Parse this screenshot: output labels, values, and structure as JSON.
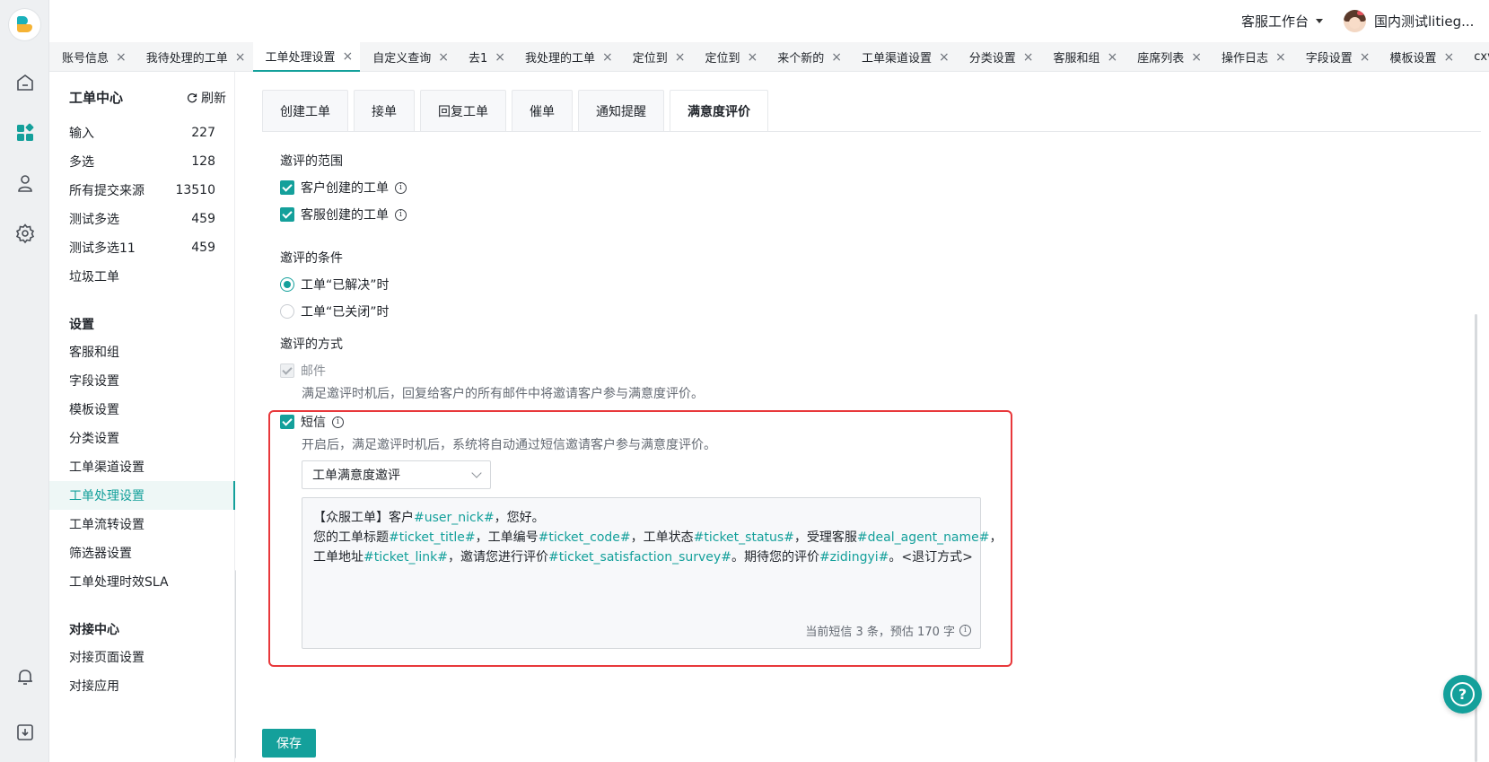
{
  "rail": {
    "icons": [
      "logo-icon",
      "home-icon",
      "apps-icon",
      "user-icon",
      "settings-icon",
      "bell-icon",
      "download-icon"
    ]
  },
  "topbar": {
    "workspace": "客服工作台",
    "user_name": "国内测试litieg..."
  },
  "tabs": [
    {
      "label": "账号信息"
    },
    {
      "label": "我待处理的工单"
    },
    {
      "label": "工单处理设置",
      "active": true
    },
    {
      "label": "自定义查询"
    },
    {
      "label": "去1"
    },
    {
      "label": "我处理的工单"
    },
    {
      "label": "定位到"
    },
    {
      "label": "定位到"
    },
    {
      "label": "来个新的"
    },
    {
      "label": "工单渠道设置"
    },
    {
      "label": "分类设置"
    },
    {
      "label": "客服和组"
    },
    {
      "label": "座席列表"
    },
    {
      "label": "操作日志"
    },
    {
      "label": "字段设置"
    },
    {
      "label": "模板设置"
    },
    {
      "label": "cxvx"
    }
  ],
  "tab_close": "×",
  "sidebar": {
    "title": "工单中心",
    "refresh": "刷新",
    "views": [
      {
        "label": "输入",
        "count": "227"
      },
      {
        "label": "多选",
        "count": "128"
      },
      {
        "label": "所有提交来源",
        "count": "13510"
      },
      {
        "label": "测试多选",
        "count": "459"
      },
      {
        "label": "测试多选11",
        "count": "459"
      },
      {
        "label": "垃圾工单",
        "count": ""
      }
    ],
    "settings_title": "设置",
    "settings": [
      {
        "label": "客服和组"
      },
      {
        "label": "字段设置"
      },
      {
        "label": "模板设置"
      },
      {
        "label": "分类设置"
      },
      {
        "label": "工单渠道设置"
      },
      {
        "label": "工单处理设置",
        "active": true
      },
      {
        "label": "工单流转设置"
      },
      {
        "label": "筛选器设置"
      },
      {
        "label": "工单处理时效SLA"
      }
    ],
    "integration_title": "对接中心",
    "integration": [
      {
        "label": "对接页面设置"
      },
      {
        "label": "对接应用"
      }
    ]
  },
  "subtabs": [
    {
      "label": "创建工单"
    },
    {
      "label": "接单"
    },
    {
      "label": "回复工单"
    },
    {
      "label": "催单"
    },
    {
      "label": "通知提醒"
    },
    {
      "label": "满意度评价",
      "active": true
    }
  ],
  "scope": {
    "title": "邀评的范围",
    "options": [
      {
        "label": "客户创建的工单",
        "checked": true
      },
      {
        "label": "客服创建的工单",
        "checked": true
      }
    ]
  },
  "condition": {
    "title": "邀评的条件",
    "options": [
      {
        "label": "工单“已解决”时",
        "selected": true
      },
      {
        "label": "工单“已关闭”时",
        "selected": false
      }
    ]
  },
  "method": {
    "title": "邀评的方式",
    "email": {
      "label": "邮件",
      "checked": true,
      "disabled": true,
      "hint": "满足邀评时机后，回复给客户的所有邮件中将邀请客户参与满意度评价。"
    },
    "sms": {
      "label": "短信",
      "checked": true,
      "hint": "开启后，满足邀评时机后，系统将自动通过短信邀请客户参与满意度评价。",
      "template": "工单满意度邀评",
      "body": {
        "p1": "【众服工单】客户",
        "v1": "#user_nick#",
        "p2": "，您好。",
        "p3": "您的工单标题",
        "v2": "#ticket_title#",
        "p4": "，工单编号",
        "v3": "#ticket_code#",
        "p5": "，工单状态",
        "v4": "#ticket_status#",
        "p6": "，受理客服",
        "v5": "#deal_agent_name#",
        "p7": "，工单地址",
        "v6": "#ticket_link#",
        "p8": "，邀请您进行评价",
        "v7": "#ticket_satisfaction_survey#",
        "p9": "。期待您的评价",
        "v8": "#zidingyi#",
        "p10": "。<退订方式>"
      },
      "count": "当前短信 3 条，预估 170 字"
    }
  },
  "save_label": "保存",
  "help_label": "?",
  "colors": {
    "accent": "#14a09b",
    "highlight": "#e8383b"
  }
}
